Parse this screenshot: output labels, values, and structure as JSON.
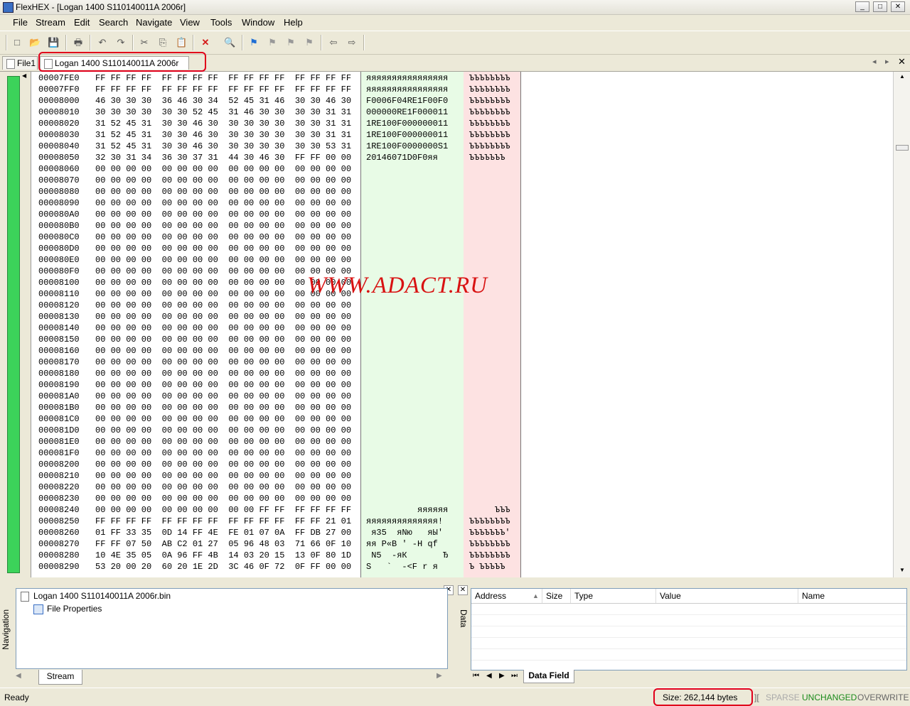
{
  "window": {
    "title": "FlexHEX - [Logan 1400 S110140011A 2006r]",
    "min": "_",
    "max": "□",
    "close": "✕"
  },
  "menu": [
    "File",
    "Stream",
    "Edit",
    "Search",
    "Navigate",
    "View",
    "Tools",
    "Window",
    "Help"
  ],
  "toolbar": {
    "icons": [
      "new-icon",
      "open-icon",
      "save-icon",
      "print-icon",
      "undo-icon",
      "redo-icon",
      "cut-icon",
      "copy-icon",
      "paste-icon",
      "delete-icon",
      "find-icon",
      "flag-icon",
      "flag-prev-icon",
      "flag-next-icon",
      "flag-clear-icon",
      "back-icon",
      "forward-icon"
    ],
    "glyphs": [
      "□",
      "📂",
      "💾",
      "🖶",
      "↶",
      "↷",
      "✂",
      "⎘",
      "📋",
      "✕",
      "🔍",
      "⚑",
      "⚑",
      "⚑",
      "⚑",
      "⇦",
      "⇨"
    ]
  },
  "tabs": [
    {
      "label": "File1"
    },
    {
      "label": "Logan 1400 S110140011A 2006r"
    }
  ],
  "tabnav": {
    "prev": "◂",
    "next": "▸",
    "close": "✕"
  },
  "hex": {
    "rows": [
      {
        "addr": "00007FE0",
        "bytes": "FF FF FF FF  FF FF FF FF  FF FF FF FF  FF FF FF FF",
        "a1": "яяяяяяяяяяяяяяяя",
        "a2": "ЪЪЪЪЪЪЪЪ"
      },
      {
        "addr": "00007FF0",
        "bytes": "FF FF FF FF  FF FF FF FF  FF FF FF FF  FF FF FF FF",
        "a1": "яяяяяяяяяяяяяяяя",
        "a2": "ЪЪЪЪЪЪЪЪ"
      },
      {
        "addr": "00008000",
        "bytes": "46 30 30 30  36 46 30 34  52 45 31 46  30 30 46 30",
        "a1": "F0006F04RE1F00F0",
        "a2": "ЪЪЪЪЪЪЪЪ"
      },
      {
        "addr": "00008010",
        "bytes": "30 30 30 30  30 30 52 45  31 46 30 30  30 30 31 31",
        "a1": "000000RE1F000011",
        "a2": "ЪЪЪЪЪЪЪЪ"
      },
      {
        "addr": "00008020",
        "bytes": "31 52 45 31  30 30 46 30  30 30 30 30  30 30 31 31",
        "a1": "1RE100F000000011",
        "a2": "ЪЪЪЪЪЪЪЪ"
      },
      {
        "addr": "00008030",
        "bytes": "31 52 45 31  30 30 46 30  30 30 30 30  30 30 31 31",
        "a1": "1RE100F000000011",
        "a2": "ЪЪЪЪЪЪЪЪ"
      },
      {
        "addr": "00008040",
        "bytes": "31 52 45 31  30 30 46 30  30 30 30 30  30 30 53 31",
        "a1": "1RE100F0000000S1",
        "a2": "ЪЪЪЪЪЪЪЪ"
      },
      {
        "addr": "00008050",
        "bytes": "32 30 31 34  36 30 37 31  44 30 46 30  FF FF 00 00",
        "a1": "20146071D0F0яя",
        "a2": "ЪЪЪЪЪЪЪ"
      },
      {
        "addr": "00008060",
        "bytes": "00 00 00 00  00 00 00 00  00 00 00 00  00 00 00 00",
        "a1": "",
        "a2": ""
      },
      {
        "addr": "00008070",
        "bytes": "00 00 00 00  00 00 00 00  00 00 00 00  00 00 00 00",
        "a1": "",
        "a2": ""
      },
      {
        "addr": "00008080",
        "bytes": "00 00 00 00  00 00 00 00  00 00 00 00  00 00 00 00",
        "a1": "",
        "a2": ""
      },
      {
        "addr": "00008090",
        "bytes": "00 00 00 00  00 00 00 00  00 00 00 00  00 00 00 00",
        "a1": "",
        "a2": ""
      },
      {
        "addr": "000080A0",
        "bytes": "00 00 00 00  00 00 00 00  00 00 00 00  00 00 00 00",
        "a1": "",
        "a2": ""
      },
      {
        "addr": "000080B0",
        "bytes": "00 00 00 00  00 00 00 00  00 00 00 00  00 00 00 00",
        "a1": "",
        "a2": ""
      },
      {
        "addr": "000080C0",
        "bytes": "00 00 00 00  00 00 00 00  00 00 00 00  00 00 00 00",
        "a1": "",
        "a2": ""
      },
      {
        "addr": "000080D0",
        "bytes": "00 00 00 00  00 00 00 00  00 00 00 00  00 00 00 00",
        "a1": "",
        "a2": ""
      },
      {
        "addr": "000080E0",
        "bytes": "00 00 00 00  00 00 00 00  00 00 00 00  00 00 00 00",
        "a1": "",
        "a2": ""
      },
      {
        "addr": "000080F0",
        "bytes": "00 00 00 00  00 00 00 00  00 00 00 00  00 00 00 00",
        "a1": "",
        "a2": ""
      },
      {
        "addr": "00008100",
        "bytes": "00 00 00 00  00 00 00 00  00 00 00 00  00 00 00 00",
        "a1": "",
        "a2": ""
      },
      {
        "addr": "00008110",
        "bytes": "00 00 00 00  00 00 00 00  00 00 00 00  00 00 00 00",
        "a1": "",
        "a2": ""
      },
      {
        "addr": "00008120",
        "bytes": "00 00 00 00  00 00 00 00  00 00 00 00  00 00 00 00",
        "a1": "",
        "a2": ""
      },
      {
        "addr": "00008130",
        "bytes": "00 00 00 00  00 00 00 00  00 00 00 00  00 00 00 00",
        "a1": "",
        "a2": ""
      },
      {
        "addr": "00008140",
        "bytes": "00 00 00 00  00 00 00 00  00 00 00 00  00 00 00 00",
        "a1": "",
        "a2": ""
      },
      {
        "addr": "00008150",
        "bytes": "00 00 00 00  00 00 00 00  00 00 00 00  00 00 00 00",
        "a1": "",
        "a2": ""
      },
      {
        "addr": "00008160",
        "bytes": "00 00 00 00  00 00 00 00  00 00 00 00  00 00 00 00",
        "a1": "",
        "a2": ""
      },
      {
        "addr": "00008170",
        "bytes": "00 00 00 00  00 00 00 00  00 00 00 00  00 00 00 00",
        "a1": "",
        "a2": ""
      },
      {
        "addr": "00008180",
        "bytes": "00 00 00 00  00 00 00 00  00 00 00 00  00 00 00 00",
        "a1": "",
        "a2": ""
      },
      {
        "addr": "00008190",
        "bytes": "00 00 00 00  00 00 00 00  00 00 00 00  00 00 00 00",
        "a1": "",
        "a2": ""
      },
      {
        "addr": "000081A0",
        "bytes": "00 00 00 00  00 00 00 00  00 00 00 00  00 00 00 00",
        "a1": "",
        "a2": ""
      },
      {
        "addr": "000081B0",
        "bytes": "00 00 00 00  00 00 00 00  00 00 00 00  00 00 00 00",
        "a1": "",
        "a2": ""
      },
      {
        "addr": "000081C0",
        "bytes": "00 00 00 00  00 00 00 00  00 00 00 00  00 00 00 00",
        "a1": "",
        "a2": ""
      },
      {
        "addr": "000081D0",
        "bytes": "00 00 00 00  00 00 00 00  00 00 00 00  00 00 00 00",
        "a1": "",
        "a2": ""
      },
      {
        "addr": "000081E0",
        "bytes": "00 00 00 00  00 00 00 00  00 00 00 00  00 00 00 00",
        "a1": "",
        "a2": ""
      },
      {
        "addr": "000081F0",
        "bytes": "00 00 00 00  00 00 00 00  00 00 00 00  00 00 00 00",
        "a1": "",
        "a2": ""
      },
      {
        "addr": "00008200",
        "bytes": "00 00 00 00  00 00 00 00  00 00 00 00  00 00 00 00",
        "a1": "",
        "a2": ""
      },
      {
        "addr": "00008210",
        "bytes": "00 00 00 00  00 00 00 00  00 00 00 00  00 00 00 00",
        "a1": "",
        "a2": ""
      },
      {
        "addr": "00008220",
        "bytes": "00 00 00 00  00 00 00 00  00 00 00 00  00 00 00 00",
        "a1": "",
        "a2": ""
      },
      {
        "addr": "00008230",
        "bytes": "00 00 00 00  00 00 00 00  00 00 00 00  00 00 00 00",
        "a1": "",
        "a2": ""
      },
      {
        "addr": "00008240",
        "bytes": "00 00 00 00  00 00 00 00  00 00 FF FF  FF FF FF FF",
        "a1": "          яяяяяя",
        "a2": "     ЪЪЪ"
      },
      {
        "addr": "00008250",
        "bytes": "FF FF FF FF  FF FF FF FF  FF FF FF FF  FF FF 21 01",
        "a1": "яяяяяяяяяяяяяя!",
        "a2": "ЪЪЪЪЪЪЪЪ"
      },
      {
        "addr": "00008260",
        "bytes": "01 FF 33 35  0D 14 FF 4E  FE 01 07 0A  FF DB 27 00",
        "a1": " я35  яNю   яЫ'",
        "a2": "ЪЪЪЪЪЪЪ'"
      },
      {
        "addr": "00008270",
        "bytes": "FF FF 07 50  AB C2 01 27  05 96 48 03  71 66 0F 10",
        "a1": "яя P«В ' -H qf",
        "a2": "ЪЪЪЪЪЪЪЪ"
      },
      {
        "addr": "00008280",
        "bytes": "10 4E 35 05  0A 96 FF 4B  14 03 20 15  13 0F 80 1D",
        "a1": " N5  -яК       Ђ",
        "a2": "ЪЪЪЪЪЪЪЪ"
      },
      {
        "addr": "00008290",
        "bytes": "53 20 00 20  60 20 1E 2D  3C 46 0F 72  0F FF 00 00",
        "a1": "S   `  -<F r я",
        "a2": "Ъ ЪЪЪЪЪ"
      }
    ]
  },
  "watermark": "WWW.ADACT.RU",
  "navigation": {
    "label": "Navigation",
    "file": "Logan 1400 S110140011A 2006r.bin",
    "child": "File Properties",
    "tab": "Stream"
  },
  "data": {
    "label": "Data",
    "columns": [
      "Address",
      "Size",
      "Type",
      "Value",
      "Name"
    ],
    "tab": "Data Field"
  },
  "status": {
    "ready": "Ready",
    "size": "Size: 262,144 bytes",
    "sparse": "SPARSE",
    "unchanged": "UNCHANGED",
    "overwrite": "OVERWRITE"
  },
  "colors": {
    "accent_green": "#3cd35a",
    "highlight_red": "#e0001b",
    "unchanged_green": "#1a8a1a"
  }
}
